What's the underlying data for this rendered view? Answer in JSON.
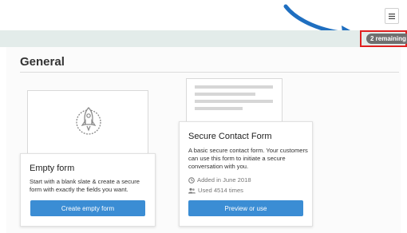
{
  "header": {
    "menu_icon": "hamburger-icon"
  },
  "strip": {
    "badge_text": "2 remaining",
    "highlight_color": "#e02020",
    "arrow_color": "#1f6fc0"
  },
  "section": {
    "title": "General"
  },
  "templates": [
    {
      "preview_icon": "rocket-icon",
      "title": "Empty form",
      "description": "Start with a blank slate & create a secure form with exactly the fields you want.",
      "button_label": "Create empty form"
    },
    {
      "title": "Secure Contact Form",
      "description": "A basic secure contact form. Your customers can use this form to initiate a secure conversation with you.",
      "added_icon": "clock-icon",
      "added_text": "Added in June 2018",
      "used_icon": "users-icon",
      "used_text": "Used 4514 times",
      "button_label": "Preview or use"
    }
  ],
  "colors": {
    "accent": "#3b8dd4",
    "strip_bg": "#e3ecea",
    "badge_bg": "#6f6f6f"
  }
}
